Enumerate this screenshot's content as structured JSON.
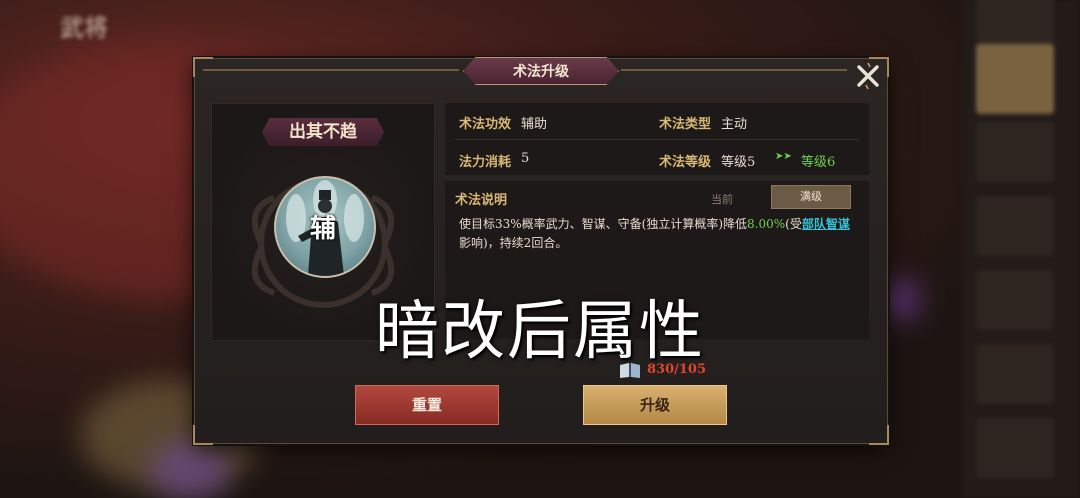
{
  "background": {
    "top_left_title": "武将"
  },
  "dialog": {
    "title": "术法升级",
    "close_icon": "close-x-icon"
  },
  "skill": {
    "name": "出其不趋",
    "role_char": "辅"
  },
  "info": {
    "effect_label": "术法功效",
    "effect_value": "辅助",
    "type_label": "术法类型",
    "type_value": "主动",
    "mana_label": "法力消耗",
    "mana_value": "5",
    "level_label": "术法等级",
    "level_current": "等级5",
    "level_arrow": "➤➤",
    "level_next": "等级6"
  },
  "description": {
    "title": "术法说明",
    "tab_current": "当前",
    "tab_max": "满级",
    "text_1": "使目标33%概率武力、智谋、守备(独立计算概率)降低",
    "text_pct": "8.00%",
    "text_2": "(受",
    "link_1": "部队",
    "link_2": "智谋",
    "text_3": "影响)，持续2回合。"
  },
  "cost": {
    "icon": "book-icon",
    "value": "830/105"
  },
  "buttons": {
    "reset": "重置",
    "upgrade": "升级"
  },
  "overlay_caption": "暗改后属性",
  "colors": {
    "accent_gold": "#d8b875",
    "green": "#6fd14f",
    "link": "#33c3d6",
    "cost_red": "#e2452e"
  }
}
